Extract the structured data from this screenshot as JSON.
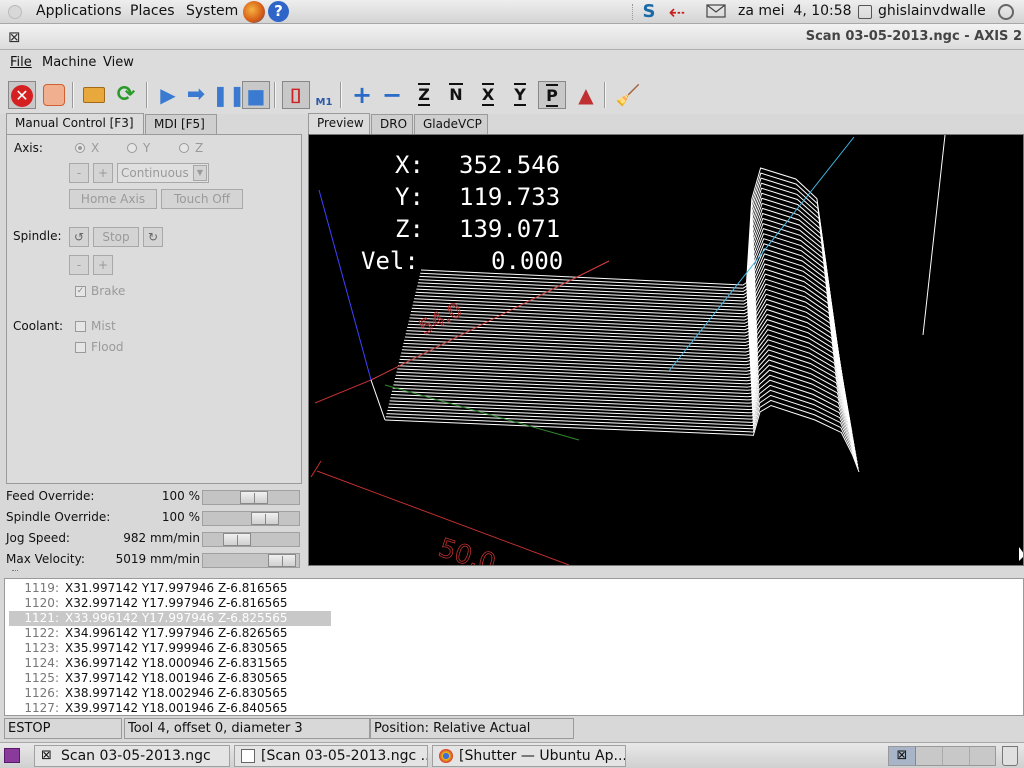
{
  "top_panel": {
    "applications": "Applications",
    "places": "Places",
    "system": "System",
    "datetime": "za mei  4, 10:58",
    "user": "ghislainvdwalle"
  },
  "window": {
    "title": "Scan 03-05-2013.ngc - AXIS 2"
  },
  "menubar": {
    "file": "File",
    "machine": "Machine",
    "view": "View"
  },
  "toolbar": {
    "buttons": [
      "estop-icon",
      "power-icon",
      "open-folder-icon",
      "reload-icon",
      "run-icon",
      "step-icon",
      "pause-icon",
      "stop-icon",
      "block-delete-icon",
      "optional-stop-icon",
      "zoom-in-icon",
      "zoom-out-icon",
      "view-z-icon",
      "view-z2-icon",
      "view-x-icon",
      "view-y-icon",
      "view-p-icon",
      "rotate-icon",
      "clear-plot-icon"
    ],
    "zoom_in_glyph": "+",
    "zoom_out_glyph": "−",
    "z_glyph": "Z",
    "x_glyph": "X",
    "y_glyph": "Y",
    "p_glyph": "P",
    "m1_glyph": "M1"
  },
  "left_tabs": {
    "manual": "Manual Control [F3]",
    "mdi": "MDI [F5]"
  },
  "manual": {
    "axis_label": "Axis:",
    "axis_x": "X",
    "axis_y": "Y",
    "axis_z": "Z",
    "minus": "-",
    "plus": "+",
    "jog_mode": "Continuous",
    "home_axis": "Home Axis",
    "touch_off": "Touch Off",
    "spindle_label": "Spindle:",
    "spindle_stop": "Stop",
    "brake": "Brake",
    "coolant_label": "Coolant:",
    "mist": "Mist",
    "flood": "Flood"
  },
  "overrides": [
    {
      "label": "Feed Override:",
      "value": "100 %",
      "fraction": 0.55
    },
    {
      "label": "Spindle Override:",
      "value": "100 %",
      "fraction": 0.7
    },
    {
      "label": "Jog Speed:",
      "value": "982 mm/min",
      "fraction": 0.3
    },
    {
      "label": "Max Velocity:",
      "value": "5019 mm/min",
      "fraction": 0.95
    }
  ],
  "right_tabs": {
    "preview": "Preview",
    "dro": "DRO",
    "gladevcp": "GladeVCP"
  },
  "dro": {
    "x_label": "X:",
    "x_value": "352.546",
    "y_label": "Y:",
    "y_value": "119.733",
    "z_label": "Z:",
    "z_value": "139.071",
    "vel_label": "Vel:",
    "vel_value": "0.000",
    "dim_a": "54.0",
    "dim_b": "50.0"
  },
  "gcode": [
    {
      "n": "1119:",
      "code": "X31.997142 Y17.997946 Z-6.816565"
    },
    {
      "n": "1120:",
      "code": "X32.997142 Y17.997946 Z-6.816565"
    },
    {
      "n": "1121:",
      "code": "X33.996142 Y17.997946 Z-6.825565"
    },
    {
      "n": "1122:",
      "code": "X34.996142 Y17.997946 Z-6.826565"
    },
    {
      "n": "1123:",
      "code": "X35.997142 Y17.999946 Z-6.830565"
    },
    {
      "n": "1124:",
      "code": "X36.997142 Y18.000946 Z-6.831565"
    },
    {
      "n": "1125:",
      "code": "X37.997142 Y18.001946 Z-6.830565"
    },
    {
      "n": "1126:",
      "code": "X38.997142 Y18.002946 Z-6.830565"
    },
    {
      "n": "1127:",
      "code": "X39.997142 Y18.001946 Z-6.840565"
    }
  ],
  "status": {
    "state": "ESTOP",
    "tool": "Tool 4, offset 0, diameter 3",
    "position": "Position: Relative Actual"
  },
  "taskbar": [
    {
      "label": "Scan 03-05-2013.ngc"
    },
    {
      "label": "[Scan 03-05-2013.ngc ..."
    },
    {
      "label": "[Shutter — Ubuntu Ap..."
    }
  ]
}
